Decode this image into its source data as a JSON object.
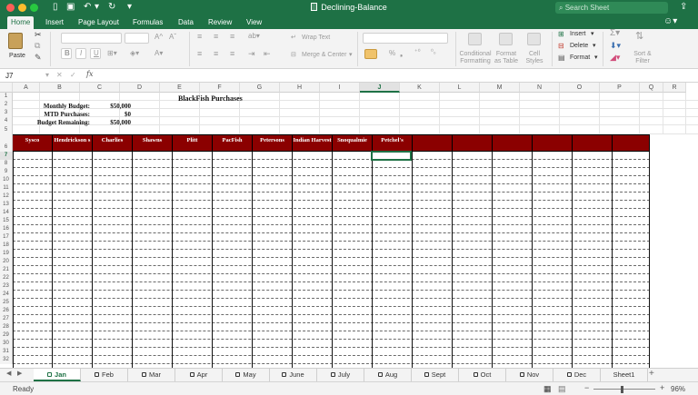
{
  "window": {
    "title": "Declining-Balance",
    "search_placeholder": "Search Sheet"
  },
  "ribbon_tabs": [
    "Home",
    "Insert",
    "Page Layout",
    "Formulas",
    "Data",
    "Review",
    "View"
  ],
  "ribbon": {
    "paste": "Paste",
    "wrap_text": "Wrap Text",
    "merge_center": "Merge & Center",
    "conditional_formatting": [
      "Conditional",
      "Formatting"
    ],
    "format_as_table": [
      "Format",
      "as Table"
    ],
    "cell_styles": [
      "Cell",
      "Styles"
    ],
    "insert": "Insert",
    "delete": "Delete",
    "format": "Format",
    "sort_filter": [
      "Sort &",
      "Filter"
    ],
    "bold": "B",
    "italic": "I",
    "underline": "U"
  },
  "formula_bar": {
    "name_box": "J7",
    "fx": "fx",
    "formula": ""
  },
  "columns": [
    "A",
    "B",
    "C",
    "D",
    "E",
    "F",
    "G",
    "H",
    "I",
    "J",
    "K",
    "L",
    "M",
    "N",
    "O",
    "P",
    "Q",
    "R"
  ],
  "selected_column": "J",
  "rows": [
    "1",
    "2",
    "3",
    "4",
    "5",
    "6",
    "7",
    "8",
    "9",
    "10",
    "11",
    "12",
    "13",
    "14",
    "15",
    "16",
    "17",
    "18",
    "19",
    "20",
    "21",
    "22",
    "23",
    "24",
    "25",
    "26",
    "27",
    "28",
    "29",
    "30",
    "31",
    "32"
  ],
  "selected_row": "7",
  "sheet": {
    "title": "BlackFish Purchases",
    "summary": [
      {
        "label": "Monthly Budget:",
        "value": "$50,000"
      },
      {
        "label": "MTD Purchases:",
        "value": "$0"
      },
      {
        "label": "Budget Remaining:",
        "value": "$50,000"
      }
    ],
    "vendors": [
      "Sysco",
      "Hendrickson s",
      "Charlies",
      "Shawns",
      "Plitt",
      "PacFish",
      "Petersons",
      "Indian Harvest",
      "Snoqualmie",
      "Petchel's",
      "",
      "",
      "",
      "",
      "",
      ""
    ]
  },
  "sheet_tabs": [
    "Jan",
    "Feb",
    "Mar",
    "Apr",
    "May",
    "June",
    "July",
    "Aug",
    "Sept",
    "Oct",
    "Nov",
    "Dec",
    "Sheet1"
  ],
  "active_sheet": "Jan",
  "status": {
    "ready": "Ready",
    "zoom": "96%"
  },
  "colors": {
    "accent": "#1e7145",
    "header_fill": "#8b0000"
  }
}
